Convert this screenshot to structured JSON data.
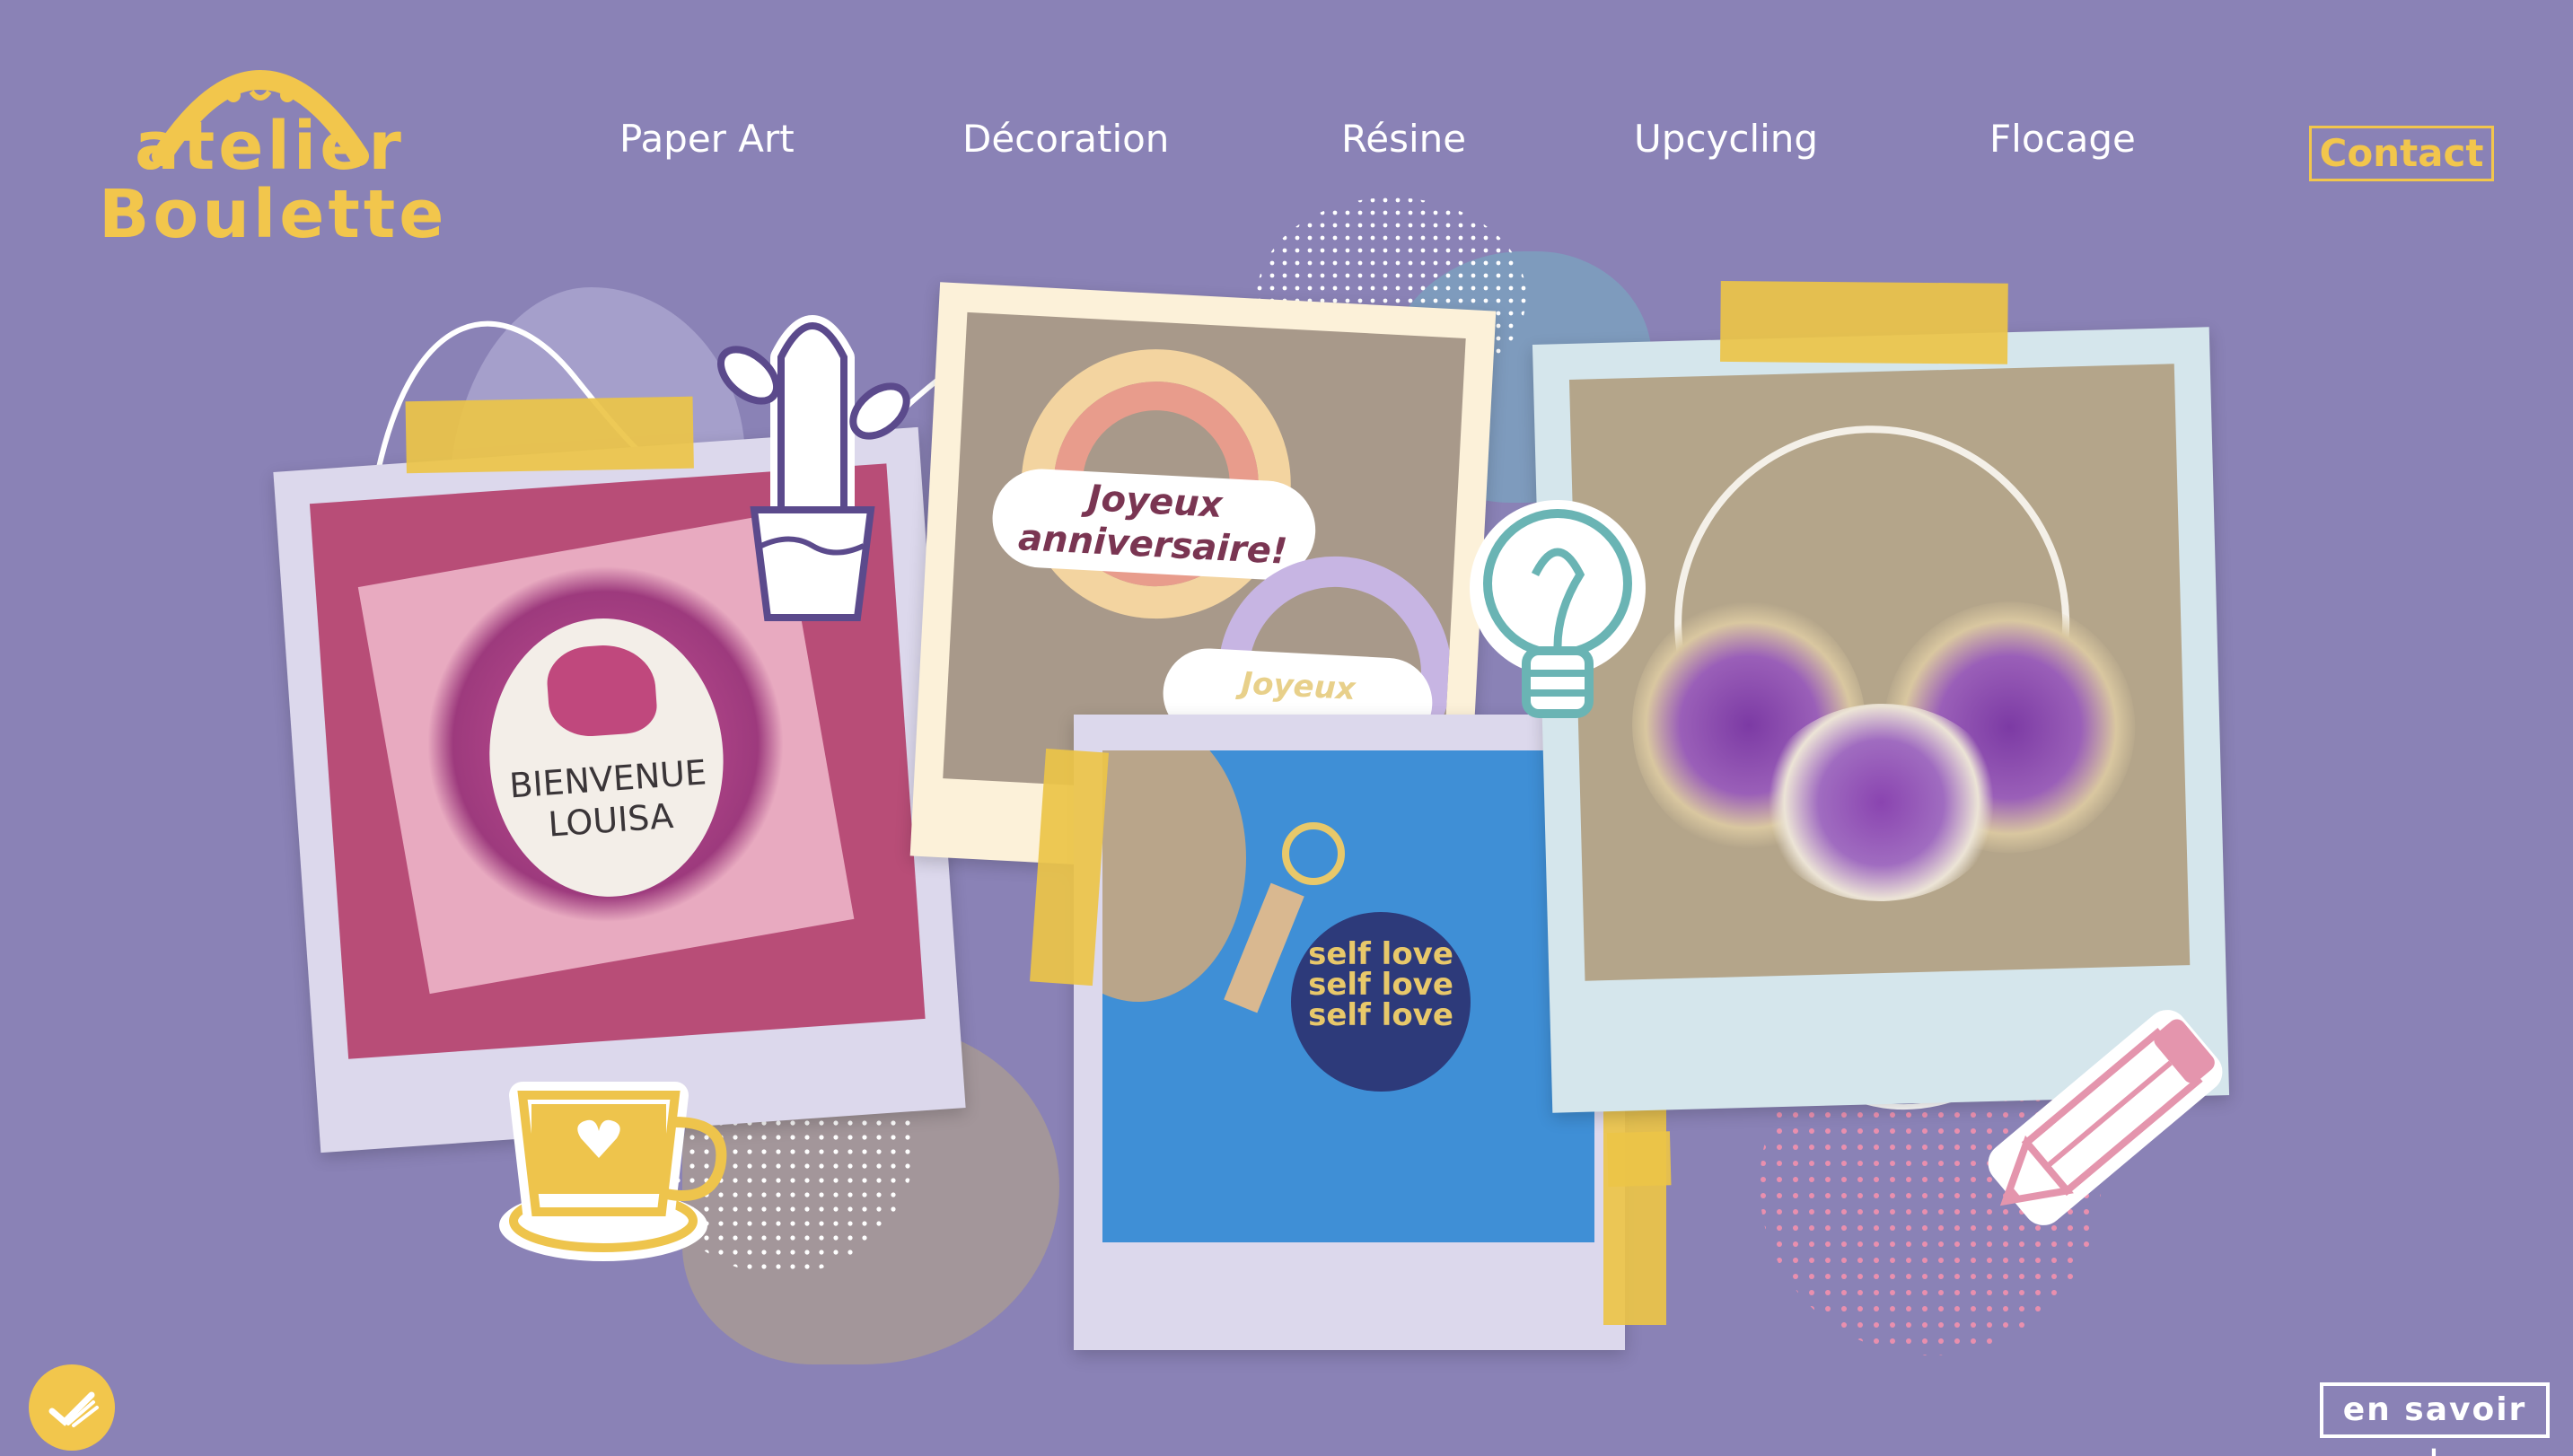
{
  "brand": {
    "logo_line1": "atelier",
    "logo_line2": "Boulette",
    "color": "#f2c64c"
  },
  "nav": {
    "items": [
      {
        "label": "Paper Art"
      },
      {
        "label": "Décoration"
      },
      {
        "label": "Résine"
      },
      {
        "label": "Upcycling"
      },
      {
        "label": "Flocage"
      }
    ],
    "contact_label": "Contact"
  },
  "photos": {
    "card": {
      "line1": "BIENVENUE",
      "line2": "LOUISA"
    },
    "cake_topper": {
      "line1": "Joyeux",
      "line2": "anniversaire!",
      "line3": "Joyeux"
    },
    "keychain": {
      "text": "self love self love self love"
    },
    "wreath": {}
  },
  "stickers": [
    "cactus-icon",
    "lightbulb-icon",
    "coffee-cup-icon",
    "pencil-icon"
  ],
  "footer": {
    "savoir_label": "en savoir +"
  },
  "colors": {
    "background": "#8a82b6",
    "accent": "#f2c64c",
    "tape": "#ecc448"
  }
}
